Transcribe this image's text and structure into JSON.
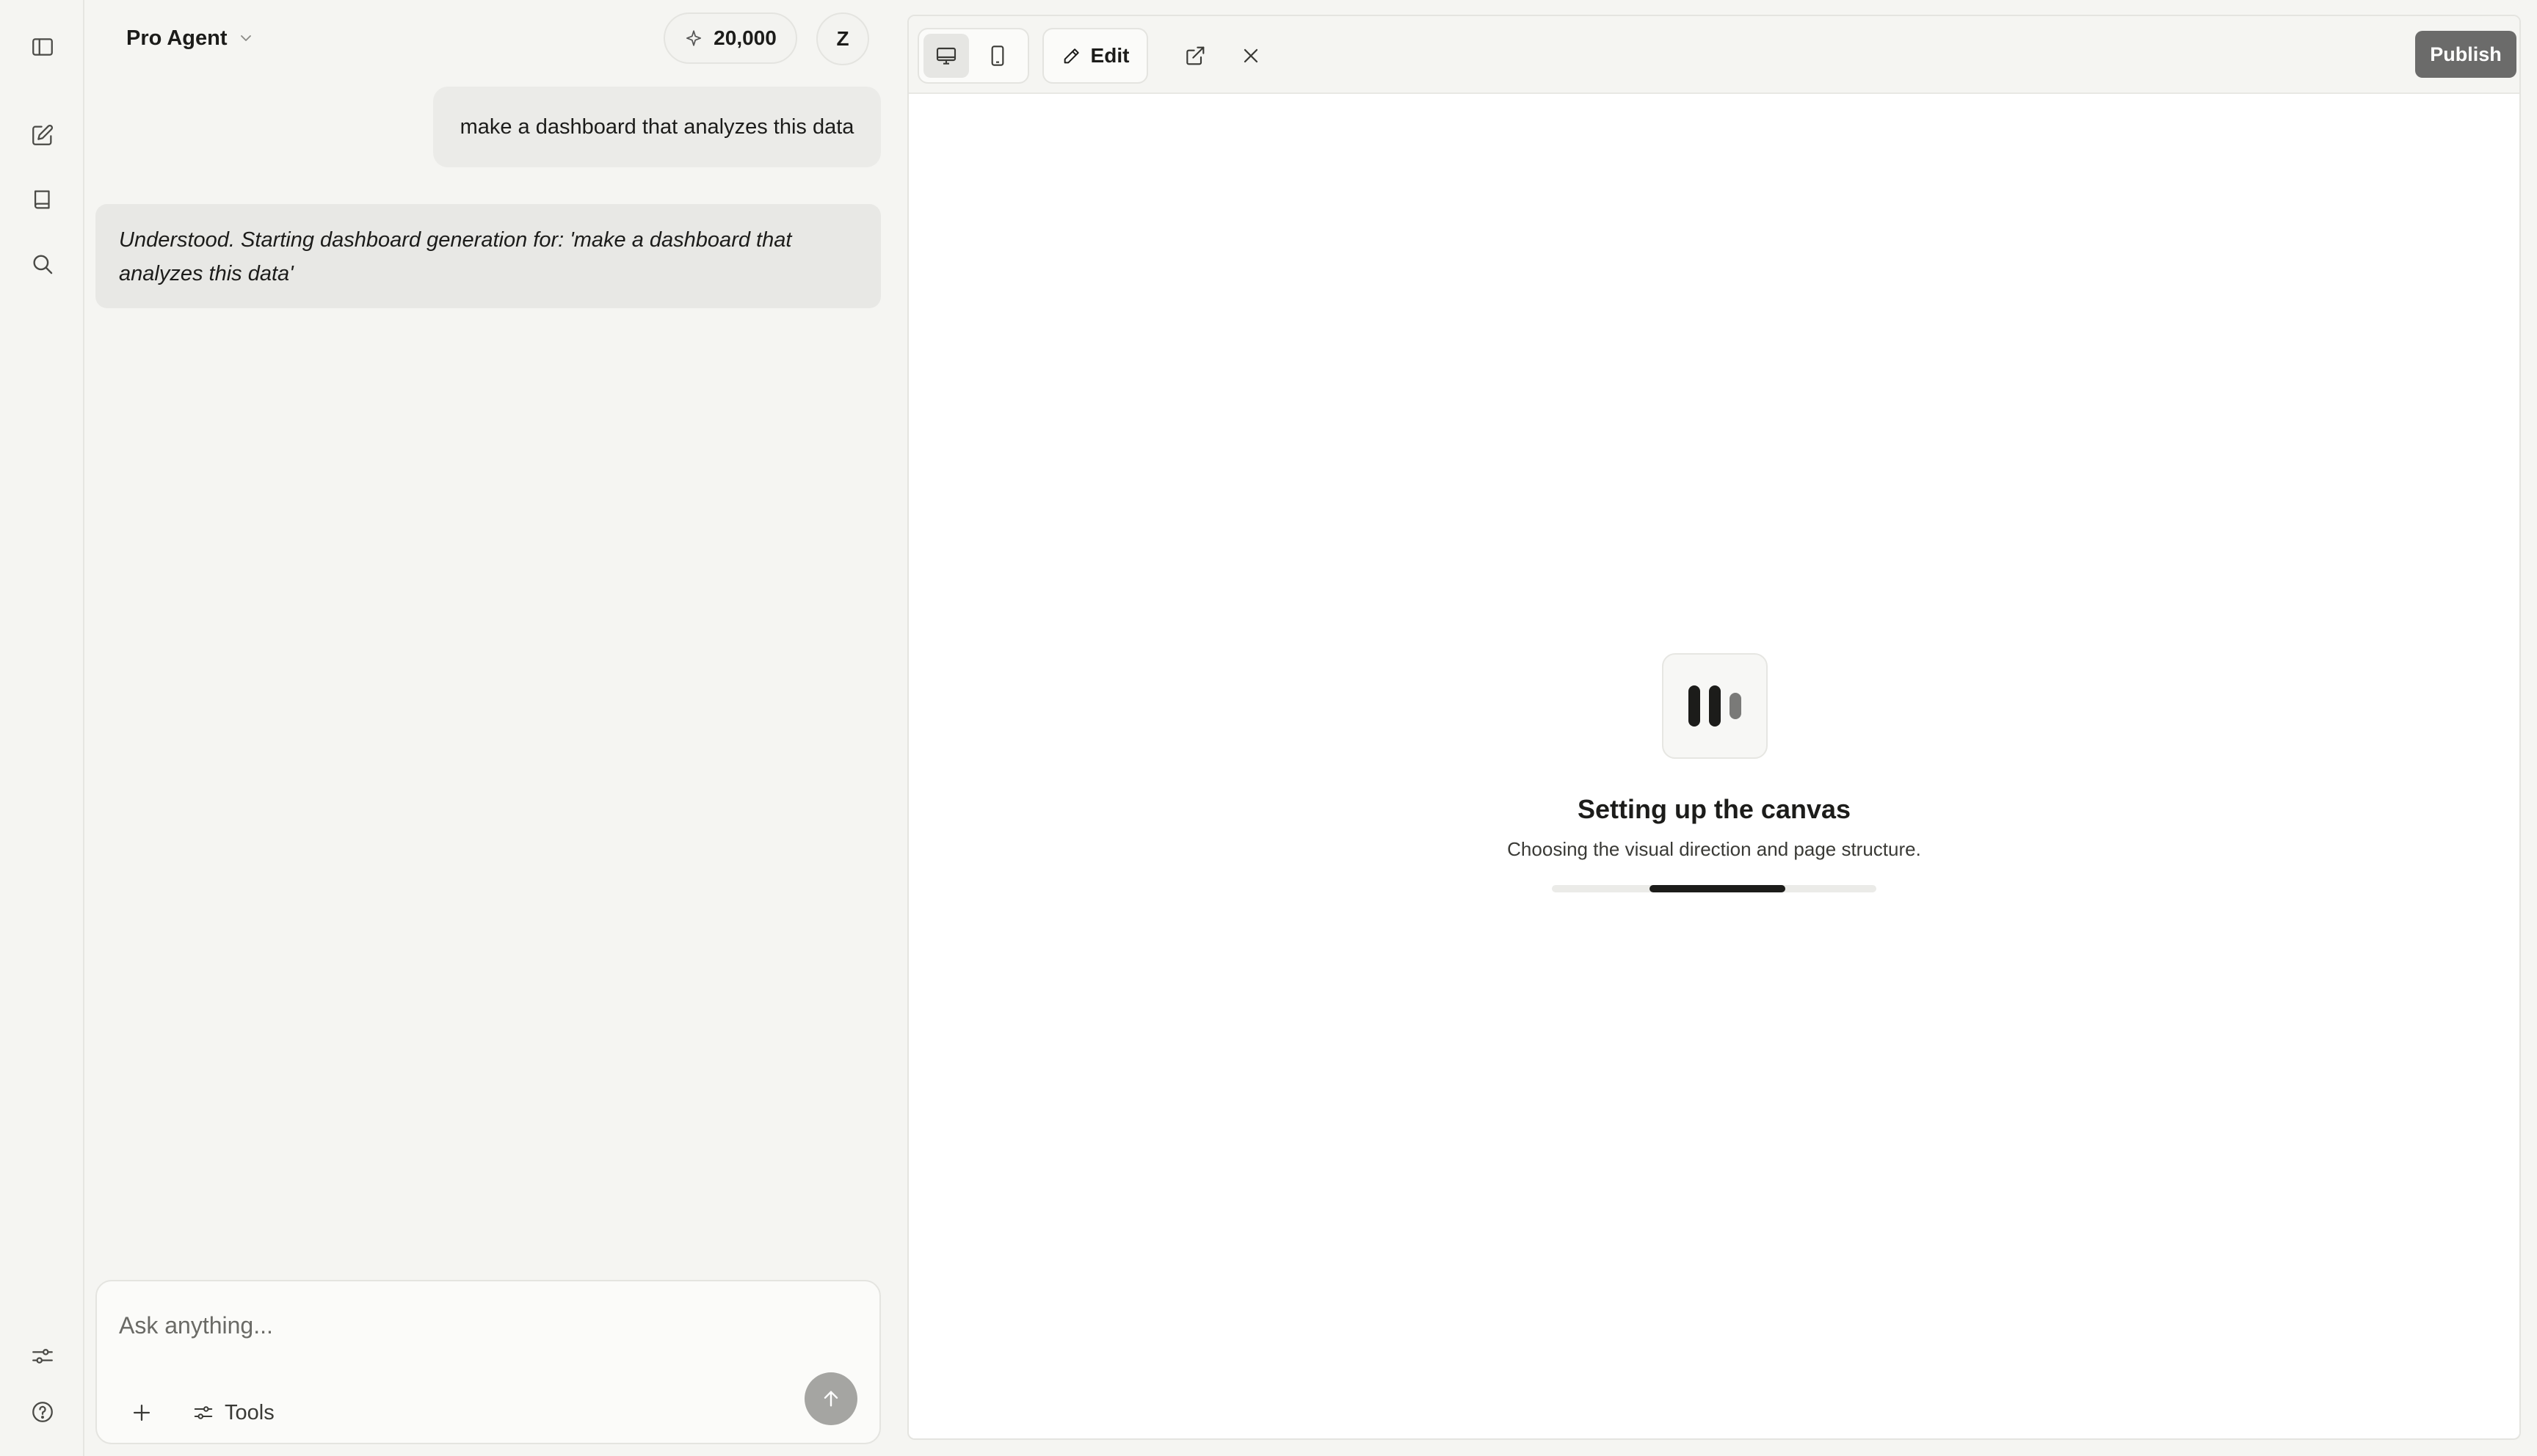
{
  "header": {
    "agent_label": "Pro Agent",
    "credits": "20,000",
    "avatar_initial": "Z"
  },
  "rail": {
    "icons": [
      "sidebar-toggle-icon",
      "new-chat-icon",
      "library-icon",
      "search-icon",
      "settings-sliders-icon",
      "help-icon"
    ]
  },
  "chat": {
    "user_message": "make a dashboard that analyzes this data",
    "agent_message": "Understood. Starting dashboard generation for: 'make a dashboard that analyzes this data'"
  },
  "composer": {
    "placeholder": "Ask anything...",
    "tools_label": "Tools"
  },
  "preview": {
    "edit_label": "Edit",
    "publish_label": "Publish",
    "active_device": "desktop",
    "loading_title": "Setting up the canvas",
    "loading_subtitle": "Choosing the visual direction and page structure.",
    "progress": {
      "start": 0.3,
      "end": 0.72
    }
  },
  "colors": {
    "background": "#f5f5f2",
    "accent_dark": "#1c1c1a",
    "publish": "#6b6b6a",
    "send_disabled": "#a5a5a2"
  }
}
